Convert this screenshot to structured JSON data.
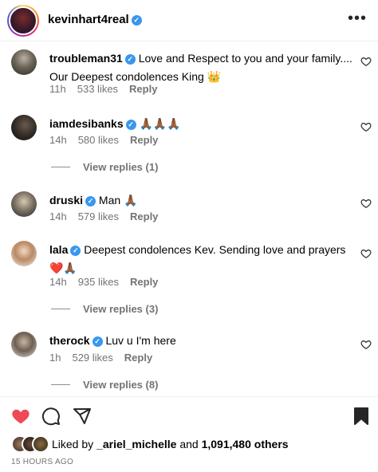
{
  "header": {
    "username": "kevinhart4real",
    "more_icon": "more-horizontal-icon"
  },
  "comments": [
    {
      "username": "troubleman31",
      "text": "Love and Respect to you and your family.... Our Deepest condolences King 👑",
      "time": "11h",
      "likes": "533 likes",
      "reply": "Reply",
      "verified": true
    },
    {
      "username": "iamdesibanks",
      "text": "🙏🏾🙏🏾🙏🏾",
      "time": "14h",
      "likes": "580 likes",
      "reply": "Reply",
      "verified": true,
      "view_replies": "View replies (1)"
    },
    {
      "username": "druski",
      "text": "Man 🙏🏾",
      "time": "14h",
      "likes": "579 likes",
      "reply": "Reply",
      "verified": true
    },
    {
      "username": "lala",
      "text": "Deepest condolences Kev. Sending love and prayers ❤️🙏🏾",
      "time": "14h",
      "likes": "935 likes",
      "reply": "Reply",
      "verified": true,
      "view_replies": "View replies (3)"
    },
    {
      "username": "therock",
      "text": "Luv u I'm here",
      "time": "1h",
      "likes": "529 likes",
      "reply": "Reply",
      "verified": true,
      "view_replies": "View replies (8)"
    }
  ],
  "actions": {
    "like_icon": "heart-filled-icon",
    "comment_icon": "comment-icon",
    "share_icon": "share-icon",
    "save_icon": "bookmark-filled-icon",
    "like_color": "#ed4956"
  },
  "likes": {
    "prefix": "Liked by ",
    "user": "_ariel_michelle",
    "middle": " and ",
    "count": "1,091,480 others"
  },
  "timestamp": "15 HOURS AGO",
  "colors": {
    "verified": "#3897f0",
    "meta": "#737373"
  }
}
